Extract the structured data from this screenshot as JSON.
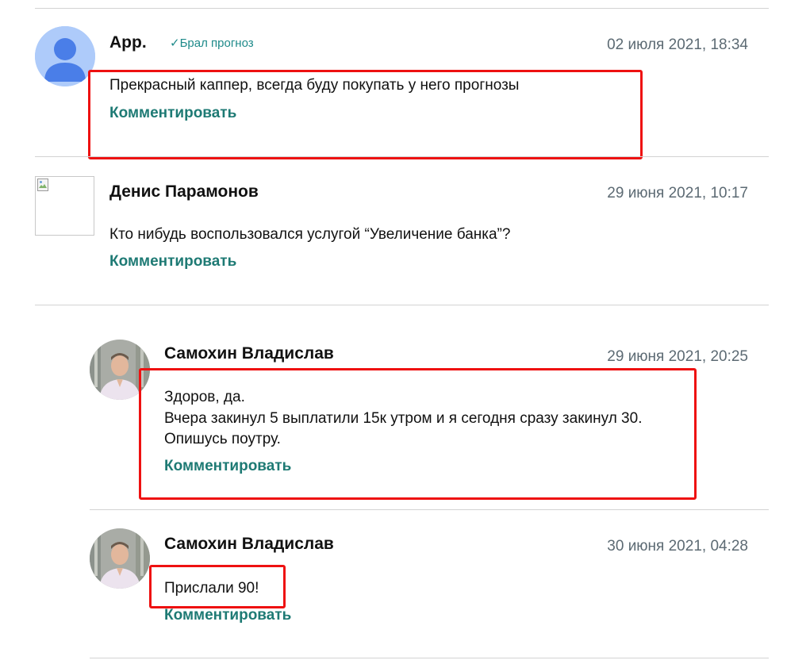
{
  "comments": [
    {
      "author": "App.",
      "badge": "Брал прогноз",
      "date": "02 июля 2021, 18:34",
      "lines": [
        "Прекрасный каппер, всегда буду покупать у него прогнозы"
      ],
      "reply": "Комментировать"
    },
    {
      "author": "Денис Парамонов",
      "date": "29 июня 2021, 10:17",
      "lines": [
        "Кто нибудь воспользовался услугой “Увеличение банка”?"
      ],
      "reply": "Комментировать"
    },
    {
      "author": "Самохин Владислав",
      "date": "29 июня 2021, 20:25",
      "lines": [
        "Здоров, да.",
        "Вчера закинул 5 выплатили 15к утром и я сегодня сразу закинул 30.",
        "Опишусь поутру."
      ],
      "reply": "Комментировать"
    },
    {
      "author": "Самохин Владислав",
      "date": "30 июня 2021, 04:28",
      "lines": [
        "Прислали 90!"
      ],
      "reply": "Комментировать"
    }
  ],
  "colors": {
    "highlight": "#ee1111",
    "reply_link": "#1e7a74",
    "badge": "#1e8a8a",
    "date": "#5c6a73",
    "divider": "#d3d3d3"
  },
  "icons": {
    "badge_icon": "checkmark-icon",
    "default_avatar": "user-silhouette-icon",
    "broken_avatar": "broken-image-icon"
  }
}
